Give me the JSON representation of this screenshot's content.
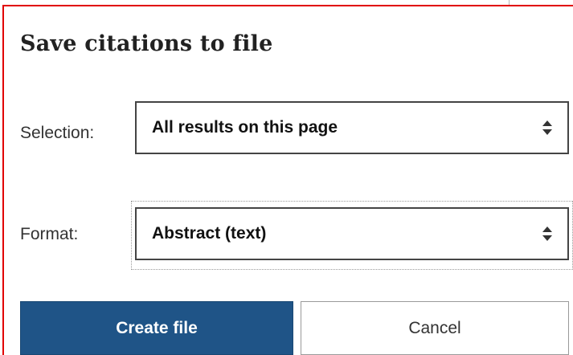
{
  "dialog": {
    "title": "Save citations to file"
  },
  "form": {
    "selection": {
      "label": "Selection:",
      "value": "All results on this page"
    },
    "format": {
      "label": "Format:",
      "value": "Abstract (text)"
    }
  },
  "actions": {
    "create_label": "Create file",
    "cancel_label": "Cancel"
  },
  "colors": {
    "accent_border": "#e10000",
    "primary_button": "#1f5487"
  },
  "icons": {
    "select_arrow": "sort-arrows-icon"
  }
}
